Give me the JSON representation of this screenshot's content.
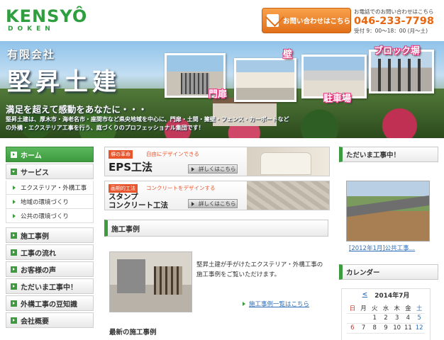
{
  "header": {
    "logo_main": "KENSYÔ",
    "logo_sub": "DOKEN",
    "contact_label": "お問い合わせはこちら",
    "tel_note": "お電話でのお問い合わせはこちら",
    "tel_number": "046-233-7798",
    "tel_hours": "受付 9：00〜18：00 (月〜土)"
  },
  "hero": {
    "company_small": "有限会社",
    "company_name": "堅昇土建",
    "tagline": "満足を超えて感動をあなたに・・・",
    "description": "堅昇土建は、厚木市・海老名市・座間市など県央地域を中心に、門扉・土間・擁壁・フェンス・カーポートなどの外構・エクステリア工事を行う、庭づくりのプロフェッショナル集団です！",
    "captions": {
      "mon": "門扉",
      "kabe": "壁",
      "chusha": "駐車場",
      "block": "ブロック塀"
    }
  },
  "left_nav": {
    "items": [
      {
        "label": "ホーム"
      },
      {
        "label": "サービス"
      },
      {
        "label": "エクステリア・外構工事"
      },
      {
        "label": "地域の環境づくり"
      },
      {
        "label": "公共の環境づくり"
      },
      {
        "label": "施工事例"
      },
      {
        "label": "工事の流れ"
      },
      {
        "label": "お客様の声"
      },
      {
        "label": "ただいま工事中！"
      },
      {
        "label": "外構工事の豆知識"
      },
      {
        "label": "会社概要"
      }
    ]
  },
  "banners": [
    {
      "tag": "塀の革命",
      "sub": "自由にデザインできる",
      "title": "EPS工法",
      "button": "詳しくはこちら"
    },
    {
      "tag": "画期的工法",
      "sub": "コンクリートをデザインする",
      "title_line1": "スタンプ",
      "title_line2": "コンクリート工法",
      "button": "詳しくはこちら"
    }
  ],
  "cases": {
    "heading": "施工事例",
    "text": "堅昇土建が手がけたエクステリア・外構工事の施工事例をご覧いただけます。",
    "link": "施工事例一覧はこちら",
    "latest": "最新の施工事例"
  },
  "right": {
    "construction_heading": "ただいま工事中！",
    "construction_link": "[2012年1月]公共工事…",
    "calendar_heading": "カレンダー",
    "calendar": {
      "prev": "<",
      "month": "2014年7月",
      "weekdays": [
        "日",
        "月",
        "火",
        "水",
        "木",
        "金",
        "土"
      ],
      "rows": [
        [
          "",
          "",
          "1",
          "2",
          "3",
          "4",
          "5"
        ],
        [
          "6",
          "7",
          "8",
          "9",
          "10",
          "11",
          "12"
        ]
      ]
    }
  }
}
